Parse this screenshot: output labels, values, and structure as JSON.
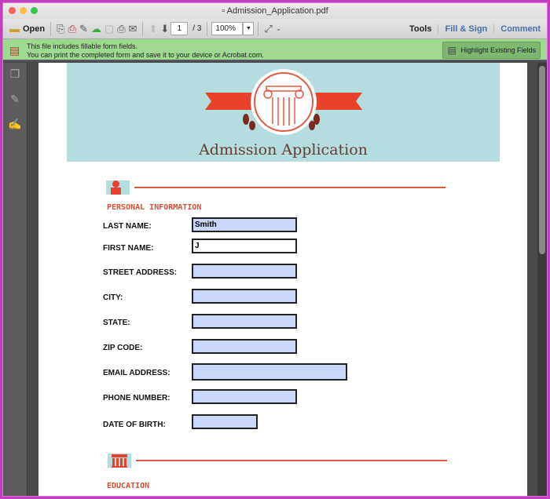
{
  "window": {
    "title": "Admission_Application.pdf"
  },
  "toolbar": {
    "open_label": "Open",
    "page_current": "1",
    "page_total": "/ 3",
    "zoom": "100%",
    "tools": "Tools",
    "fill_sign": "Fill & Sign",
    "comment": "Comment"
  },
  "notice": {
    "line1": "This file includes fillable form fields.",
    "line2": "You can print the completed form and save it to your device or Acrobat.com.",
    "button": "Highlight Existing Fields"
  },
  "document": {
    "title": "Admission Application",
    "sections": [
      {
        "title": "PERSONAL INFORMATION"
      },
      {
        "title": "EDUCATION"
      }
    ],
    "fields": [
      {
        "label": "LAST NAME:",
        "value": "Smith"
      },
      {
        "label": "FIRST NAME:",
        "value": "J"
      },
      {
        "label": "STREET ADDRESS:",
        "value": ""
      },
      {
        "label": "CITY:",
        "value": ""
      },
      {
        "label": "STATE:",
        "value": ""
      },
      {
        "label": "ZIP CODE:",
        "value": ""
      },
      {
        "label": "EMAIL ADDRESS:",
        "value": ""
      },
      {
        "label": "PHONE NUMBER:",
        "value": ""
      },
      {
        "label": "DATE OF BIRTH:",
        "value": ""
      }
    ]
  },
  "colors": {
    "accent": "#e04a30",
    "banner": "#b4dde0",
    "field": "#cbd6fb",
    "notice": "#9fd88f"
  }
}
